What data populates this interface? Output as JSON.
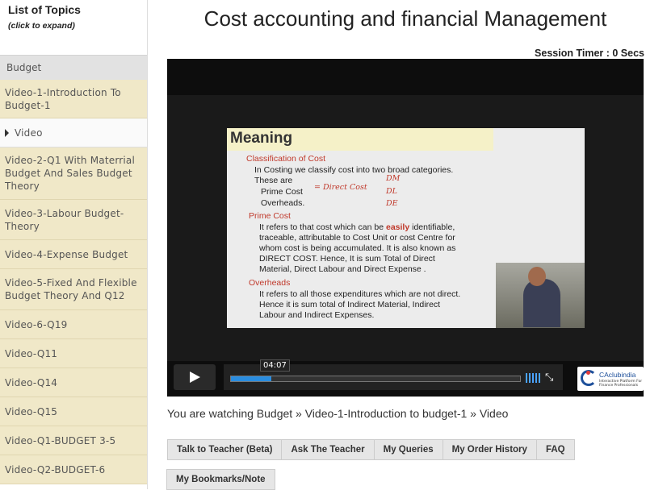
{
  "sidebar": {
    "title": "List of Topics",
    "subtitle": "(click to expand)",
    "category": "Budget",
    "items": [
      {
        "label": "Video-1-Introduction To Budget-1"
      },
      {
        "label": "Video"
      },
      {
        "label": "Video-2-Q1 With Materrial Budget And Sales Budget Theory"
      },
      {
        "label": "Video-3-Labour Budget-Theory"
      },
      {
        "label": "Video-4-Expense Budget"
      },
      {
        "label": "Video-5-Fixed And Flexible Budget Theory And Q12"
      },
      {
        "label": "Video-6-Q19"
      },
      {
        "label": "Video-Q11"
      },
      {
        "label": "Video-Q14"
      },
      {
        "label": "Video-Q15"
      },
      {
        "label": "Video-Q1-BUDGET 3-5"
      },
      {
        "label": "Video-Q2-BUDGET-6"
      }
    ]
  },
  "page": {
    "title": "Cost accounting and financial Management",
    "session_timer": "Session Timer : 0 Secs"
  },
  "player": {
    "current_time": "04:07",
    "progress": 0.14,
    "slide": {
      "title": "Meaning",
      "lines": [
        "Classification of Cost",
        "In Costing we classify cost into two broad categories.",
        "These are",
        "Prime Cost",
        "Overheads.",
        "Prime Cost",
        "It refers to that cost which can be easily identifiable,",
        "traceable, attributable to Cost Unit or cost Centre for",
        "whom cost is being accumulated. It is also known as",
        "DIRECT COST. Hence, It is sum Total of Direct",
        "Material, Direct Labour and Direct Expense .",
        "Overheads",
        "It refers to all those expenditures which are not direct.",
        "Hence it is sum total of Indirect Material, Indirect",
        "Labour and Indirect Expenses."
      ],
      "annotations": [
        "= Direct Cost",
        "DM",
        "DL",
        "DE"
      ]
    },
    "logo": {
      "name": "CAclubindia",
      "tagline": "Interactive Platform For Finance Professionals"
    }
  },
  "breadcrumb": "You are watching Budget » Video-1-Introduction to budget-1 » Video",
  "tabs": [
    "Talk to Teacher (Beta)",
    "Ask The Teacher",
    "My Queries",
    "My Order History",
    "FAQ"
  ],
  "tabs_row2": [
    "My Bookmarks/Note"
  ]
}
